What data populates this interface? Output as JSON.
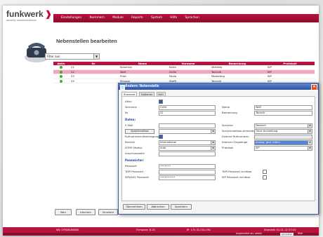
{
  "brand": {
    "name": "funkwerk",
    "sub": "security communications"
  },
  "menu": [
    "Einstellungen",
    "Nummern",
    "Module",
    "Reports",
    "System",
    "Hilfe",
    "Sprachen"
  ],
  "page": {
    "title": "Nebenstellen bearbeiten",
    "filter": "Filter aus"
  },
  "table": {
    "headers": [
      "Aktiv",
      "Nr",
      "Name",
      "Vorname",
      "Bemerkung",
      "Protokoll"
    ],
    "rows": [
      {
        "nr": "21",
        "name": "Kolumna",
        "vorname": "Karla",
        "bem": "Vertrieb",
        "prot": "SIP",
        "sel": false
      },
      {
        "nr": "22",
        "name": "Wolf",
        "vorname": "Grille",
        "bem": "Technik",
        "prot": "SIP",
        "sel": true
      },
      {
        "nr": "23",
        "name": "Frisk",
        "vorname": "Paula",
        "bem": "Marketing",
        "prot": "SIP",
        "sel": false
      },
      {
        "nr": "24",
        "name": "Strauss",
        "vorname": "Steffi",
        "bem": "Technik",
        "prot": "SIP",
        "sel": false
      }
    ]
  },
  "bottom_buttons": [
    "Neu",
    "Löschen",
    "Drucken"
  ],
  "footer": {
    "serial": "SN: 0Y50816880S",
    "firmware": "Firmware: 6.20",
    "ip": "IP: 172.31.101.091",
    "time": "Startzeit: 01.01.12 07:03",
    "user": "Angemeldet als: admin",
    "logout": "Abmelden",
    "help": "Hilfe"
  },
  "modal": {
    "title": "Ändern: Nebenstelle",
    "tabs": [
      "Standard",
      "Optionen",
      "Anti"
    ],
    "fields": {
      "aktiv_label": "Aktiv",
      "vorname_label": "Vorname",
      "vorname": "Grille",
      "name_label": "Name",
      "name": "Wolf",
      "nr_label": "Nr",
      "nr": "22",
      "bemerkung_label": "Bemerkung",
      "bemerkung": "Technik",
      "daten_section": "Daten:",
      "email_label": "E-Mail",
      "email": "",
      "sprache_label": "Sprache",
      "sprache": "Deutsch",
      "sprachmailbox_btn": "Sprachmailbox",
      "smb_label": "Sprachmailbox-Anmeldung",
      "smb": "Ohne Anmeldung",
      "rufnummer_label": "Rufnummernübertragung",
      "externe_label": "Externe Rufnummer",
      "externe": "",
      "bereich_label": "Bereich",
      "bereich": "International",
      "eingaenge_label": "Interner Eingaenge",
      "eingaenge": "Analog, gezl. intern",
      "dtmf_label": "DTMF-Modus",
      "dtmf": "Auto",
      "protokoll_label": "Protokoll",
      "protokoll": "SIP",
      "anschluss_label": "Anschlusszeile",
      "anschluss": "",
      "pw_section": "Passwörter:",
      "pw_label": "Passwort",
      "pw": "•••••••",
      "tapi_label": "TAPI Passwort",
      "tapi": "",
      "tapi_vis_label": "TAPI Passwort sichtbar",
      "sip_label": "SIP/IAX2 Passwort",
      "sip": "••••••••••",
      "sip_vis_label": "SIP Passwort sichtbar"
    },
    "buttons": [
      "Übernehmen",
      "Abbrechen",
      "Speichern"
    ]
  }
}
